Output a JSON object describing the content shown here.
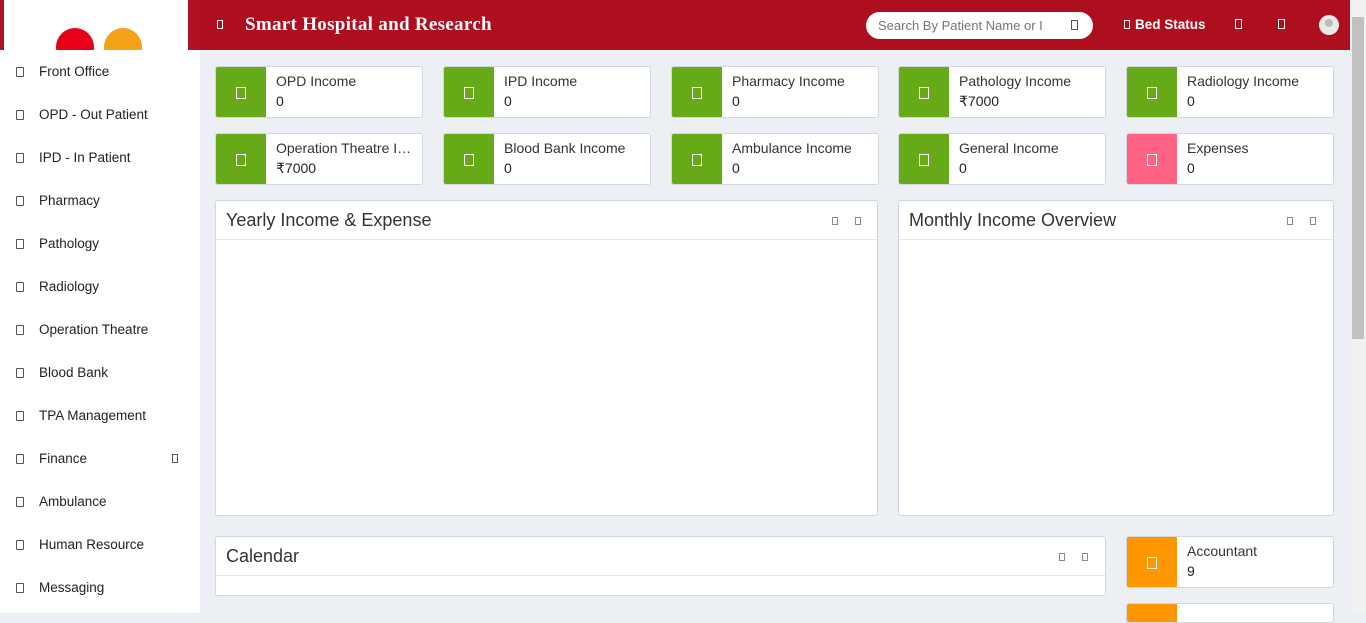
{
  "app": {
    "title": "Smart Hospital and Research"
  },
  "search": {
    "placeholder": "Search By Patient Name or I"
  },
  "header": {
    "bed_status": "Bed Status"
  },
  "sidebar": {
    "items": [
      {
        "label": "Front Office"
      },
      {
        "label": "OPD - Out Patient"
      },
      {
        "label": "IPD - In Patient"
      },
      {
        "label": "Pharmacy"
      },
      {
        "label": "Pathology"
      },
      {
        "label": "Radiology"
      },
      {
        "label": "Operation Theatre"
      },
      {
        "label": "Blood Bank"
      },
      {
        "label": "TPA Management"
      },
      {
        "label": "Finance"
      },
      {
        "label": "Ambulance"
      },
      {
        "label": "Human Resource"
      },
      {
        "label": "Messaging"
      }
    ]
  },
  "cards": [
    {
      "label": "OPD Income",
      "value": "0",
      "color": "#66aa18"
    },
    {
      "label": "IPD Income",
      "value": "0",
      "color": "#66aa18"
    },
    {
      "label": "Pharmacy Income",
      "value": "0",
      "color": "#66aa18"
    },
    {
      "label": "Pathology Income",
      "value": "₹7000",
      "color": "#66aa18"
    },
    {
      "label": "Radiology Income",
      "value": "0",
      "color": "#66aa18"
    },
    {
      "label": "Operation Theatre Income",
      "value": "₹7000",
      "color": "#66aa18"
    },
    {
      "label": "Blood Bank Income",
      "value": "0",
      "color": "#66aa18"
    },
    {
      "label": "Ambulance Income",
      "value": "0",
      "color": "#66aa18"
    },
    {
      "label": "General Income",
      "value": "0",
      "color": "#66aa18"
    },
    {
      "label": "Expenses",
      "value": "0",
      "color": "#fe6384"
    }
  ],
  "panels": {
    "yearly": "Yearly Income & Expense",
    "monthly": "Monthly Income Overview",
    "calendar": "Calendar"
  },
  "staff": {
    "label": "Accountant",
    "value": "9",
    "color": "#ff9800"
  },
  "colors": {
    "topbar": "#ae0f1f",
    "accent_green": "#66aa18",
    "expense_pink": "#fe6384",
    "staff_orange": "#ff9800"
  }
}
